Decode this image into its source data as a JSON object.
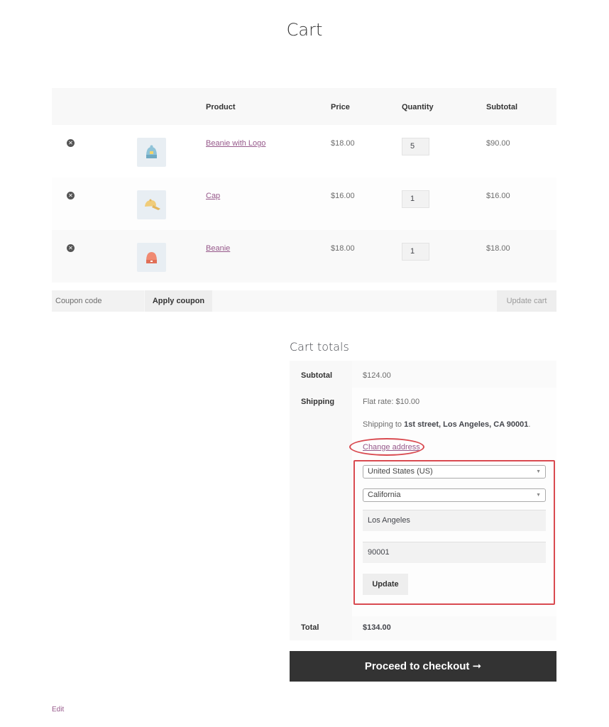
{
  "page": {
    "title": "Cart"
  },
  "cart_table": {
    "headers": {
      "product": "Product",
      "price": "Price",
      "quantity": "Quantity",
      "subtotal": "Subtotal"
    },
    "items": [
      {
        "name": "Beanie with Logo",
        "price": "$18.00",
        "quantity": "5",
        "subtotal": "$90.00",
        "thumb_icon": "beanie-logo-icon"
      },
      {
        "name": "Cap",
        "price": "$16.00",
        "quantity": "1",
        "subtotal": "$16.00",
        "thumb_icon": "cap-icon"
      },
      {
        "name": "Beanie",
        "price": "$18.00",
        "quantity": "1",
        "subtotal": "$18.00",
        "thumb_icon": "beanie-icon"
      }
    ]
  },
  "actions": {
    "coupon_placeholder": "Coupon code",
    "apply_label": "Apply coupon",
    "update_cart_label": "Update cart"
  },
  "totals": {
    "title": "Cart totals",
    "subtotal_label": "Subtotal",
    "subtotal_value": "$124.00",
    "shipping_label": "Shipping",
    "shipping_method": "Flat rate: $10.00",
    "shipping_to_prefix": "Shipping to",
    "shipping_address": "1st street, Los Angeles, CA 90001",
    "shipping_to_suffix": ".",
    "change_address": "Change address",
    "country": "United States (US)",
    "state": "California",
    "city": "Los Angeles",
    "postcode": "90001",
    "update_label": "Update",
    "total_label": "Total",
    "total_value": "$134.00"
  },
  "checkout": {
    "label": "Proceed to checkout",
    "arrow": "➞"
  },
  "footer": {
    "edit": "Edit"
  },
  "colors": {
    "link": "#96588a",
    "annotation": "#d94a50",
    "checkout_bg": "#333333"
  }
}
